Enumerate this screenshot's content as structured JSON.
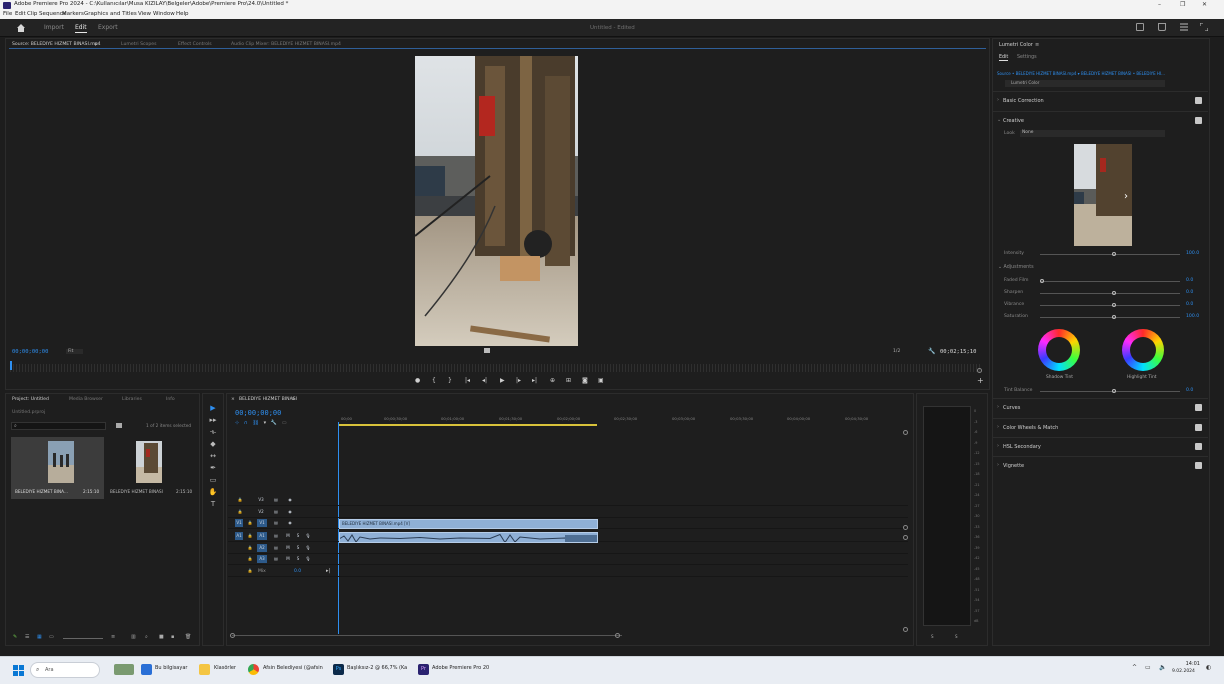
{
  "window": {
    "title": "Adobe Premiere Pro 2024 - C:\\Kullanıcılar\\Musa KIZILAY\\Belgeler\\Adobe\\Premiere Pro\\24.0\\Untitled *",
    "controls": [
      "–",
      "❐",
      "✕"
    ]
  },
  "menu": [
    "File",
    "Edit",
    "Clip",
    "Sequence",
    "Markers",
    "Graphics and Titles",
    "View",
    "Window",
    "Help"
  ],
  "header": {
    "tabs": [
      "Import",
      "Edit",
      "Export"
    ],
    "active_tab": "Edit",
    "project_title": "Untitled - Edited"
  },
  "source": {
    "tabs": [
      "Source: BELEDIYE HIZMET BINASI.mp4",
      "Lumetri Scopes",
      "Effect Controls",
      "Audio Clip Mixer: BELEDIYE HIZMET BINASI.mp4"
    ],
    "timecode": "00;00;00;00",
    "fit": "Fit",
    "scale": "1/2",
    "duration": "00;02;15;10"
  },
  "project": {
    "tabs": [
      "Project: Untitled",
      "Media Browser",
      "Libraries",
      "Info"
    ],
    "file": "Untitled.prproj",
    "selected": "1 of 2 items selected",
    "items": [
      {
        "name": "BELEDIYE HIZMET BINA...",
        "duration": "2:15:10"
      },
      {
        "name": "BELEDIYE HIZMET BINASI",
        "duration": "2:15:10"
      }
    ]
  },
  "timeline": {
    "sequence": "BELEDIYE HIZMET BINASI",
    "timecode": "00;00;00;00",
    "ruler": [
      "00;00",
      "00;00;30;00",
      "00;01;00;00",
      "00;01;30;00",
      "00;02;00;00",
      "00;02;30;00",
      "00;03;00;00",
      "00;03;30;00",
      "00;04;00;00",
      "00;04;30;00"
    ],
    "video_tracks": [
      "V3",
      "V2",
      "V1"
    ],
    "audio_tracks": [
      "A1",
      "A2",
      "A3"
    ],
    "mix_label": "Mix",
    "mix_value": "0.0",
    "clip_label": "BELEDIYE HIZMET BINASI.mp4 [V]"
  },
  "meter_scale": [
    "0",
    "-3",
    "-6",
    "-9",
    "-12",
    "-15",
    "-18",
    "-21",
    "-24",
    "-27",
    "-30",
    "-33",
    "-36",
    "-39",
    "-42",
    "-45",
    "-48",
    "-51",
    "-54",
    "-57",
    "dB"
  ],
  "meter_foot": [
    "S",
    "S"
  ],
  "lumetri": {
    "title": "Lumetri Color",
    "tabs": [
      "Edit",
      "Settings"
    ],
    "source_line": "Source • BELEDIYE HIZMET BINASI.mp4  ▾  BELEDIYE HIZMET BINASI • BELEDIYE HI...",
    "effect": "Lumetri Color",
    "sections_top": [
      "Basic Correction",
      "Creative"
    ],
    "look_label": "Look",
    "look_value": "None",
    "intensity_label": "Intensity",
    "intensity_value": "100.0",
    "adjustments_label": "Adjustments",
    "adjustments": [
      {
        "label": "Faded Film",
        "value": "0.0",
        "pos": 0.0
      },
      {
        "label": "Sharpen",
        "value": "0.0",
        "pos": 0.5
      },
      {
        "label": "Vibrance",
        "value": "0.0",
        "pos": 0.5
      },
      {
        "label": "Saturation",
        "value": "100.0",
        "pos": 0.5
      }
    ],
    "shadow_tint": "Shadow Tint",
    "highlight_tint": "Highlight Tint",
    "tint_balance_label": "Tint Balance",
    "tint_balance_value": "0.0",
    "sections_bottom": [
      "Curves",
      "Color Wheels & Match",
      "HSL Secondary",
      "Vignette"
    ]
  },
  "taskbar": {
    "search": "Ara",
    "items": [
      "Bu bilgisayar",
      "Klasörler",
      "Afsin Belediyesi (@afsin",
      "Başlıksız-2 @ 66,7% (Ka",
      "Adobe Premiere Pro 20"
    ],
    "time": "14:01",
    "date": "9.02.2024"
  }
}
